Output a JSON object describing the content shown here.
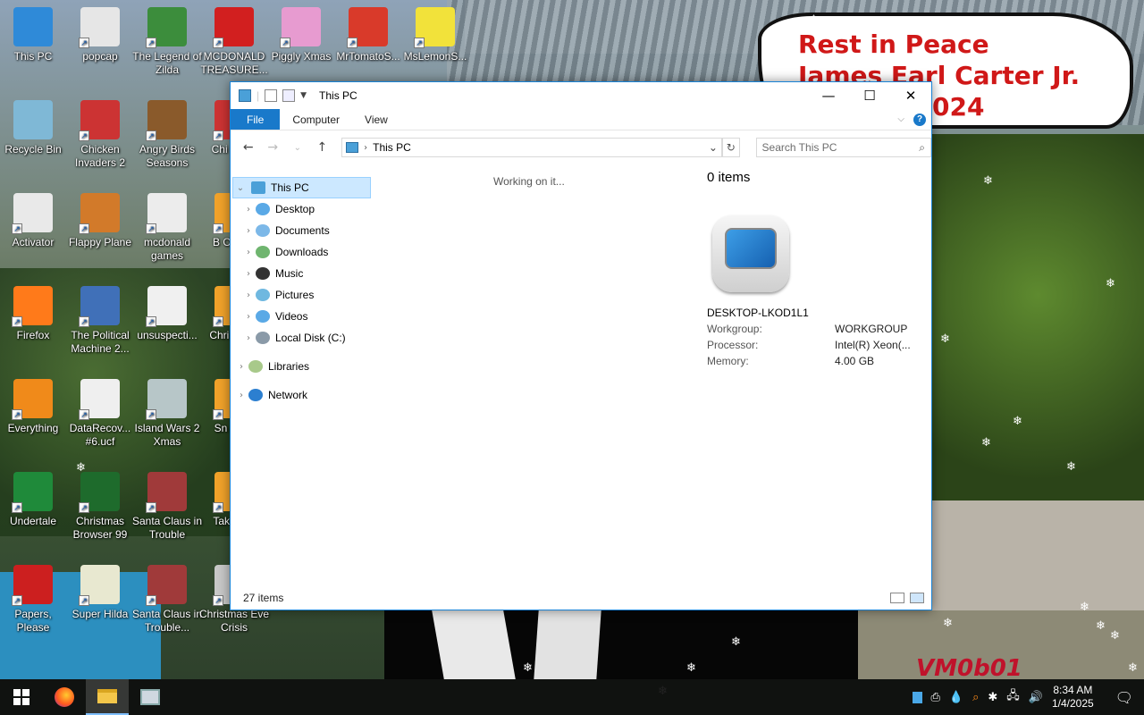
{
  "desktop": {
    "icons": [
      {
        "label": "This PC"
      },
      {
        "label": "popcap"
      },
      {
        "label": "The Legend of Zilda"
      },
      {
        "label": "MCDONALD TREASURE..."
      },
      {
        "label": "Piggly Xmas"
      },
      {
        "label": "MrTomatoS..."
      },
      {
        "label": "MsLemonS..."
      },
      {
        "label": "Recycle Bin"
      },
      {
        "label": "Chicken Invaders 2"
      },
      {
        "label": "Angry Birds Seasons"
      },
      {
        "label": "Chi Invad"
      },
      {
        "label": "Activator"
      },
      {
        "label": "Flappy Plane"
      },
      {
        "label": "mcdonald games"
      },
      {
        "label": "B Ornam"
      },
      {
        "label": "Firefox"
      },
      {
        "label": "The Political Machine 2..."
      },
      {
        "label": "unsuspecti..."
      },
      {
        "label": "Chri Swee"
      },
      {
        "label": "Everything"
      },
      {
        "label": "DataRecov... #6.ucf"
      },
      {
        "label": "Island Wars 2 Xmas"
      },
      {
        "label": "Sn Anim"
      },
      {
        "label": "Undertale"
      },
      {
        "label": "Christmas Browser 99"
      },
      {
        "label": "Santa Claus in Trouble"
      },
      {
        "label": "Tak Brea"
      },
      {
        "label": "Papers, Please"
      },
      {
        "label": "Super Hilda"
      },
      {
        "label": "Santa Claus in Trouble..."
      },
      {
        "label": "Christmas Eve Crisis"
      }
    ],
    "tribute": {
      "line1": "Rest in Peace",
      "line2": "James Earl Carter Jr.",
      "line3": "024"
    },
    "watermark": "VM0b01"
  },
  "explorer": {
    "title": "This PC",
    "ribbon_tabs": [
      "File",
      "Computer",
      "View"
    ],
    "address": "This PC",
    "search_placeholder": "Search This PC",
    "nav": {
      "root": "This PC",
      "children": [
        "Desktop",
        "Documents",
        "Downloads",
        "Music",
        "Pictures",
        "Videos",
        "Local Disk (C:)"
      ],
      "libraries": "Libraries",
      "network": "Network"
    },
    "status_loading": "Working on it...",
    "details": {
      "count": "0 items",
      "pc_name": "DESKTOP-LKOD1L1",
      "props": [
        {
          "k": "Workgroup:",
          "v": "WORKGROUP"
        },
        {
          "k": "Processor:",
          "v": "Intel(R) Xeon(..."
        },
        {
          "k": "Memory:",
          "v": "4.00 GB"
        }
      ]
    },
    "statusbar": "27 items"
  },
  "taskbar": {
    "time": "8:34 AM",
    "date": "1/4/2025"
  },
  "colors": {
    "accent": "#1979ca",
    "selection": "#cce8ff",
    "tribute": "#d01818"
  }
}
